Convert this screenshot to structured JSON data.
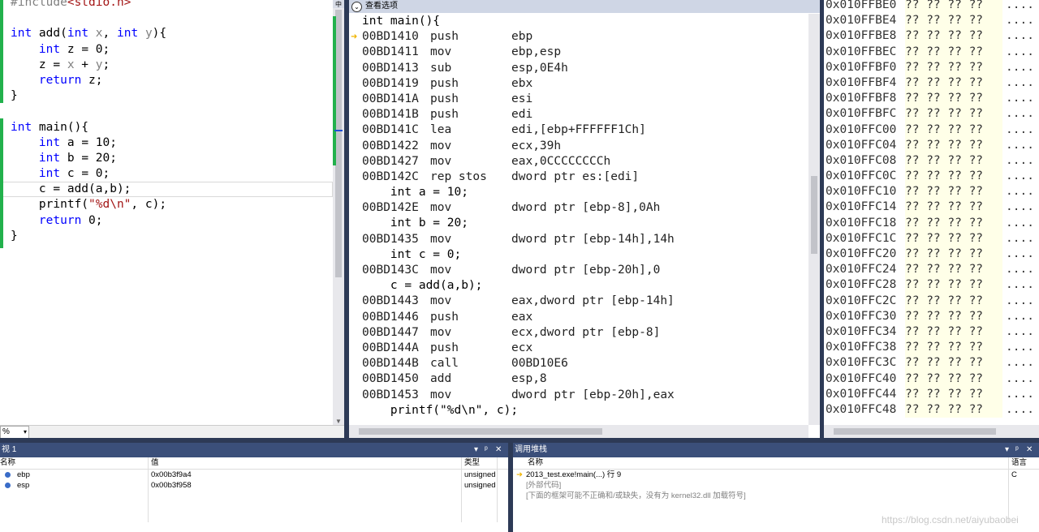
{
  "source_editor": {
    "zoom": "%",
    "lines": [
      {
        "kind": "include",
        "pp": "#include",
        "inc": "<stdio.h>"
      },
      {
        "kind": "blank"
      },
      {
        "kind": "code",
        "parts": [
          [
            "kw",
            "int"
          ],
          [
            "t",
            " add("
          ],
          [
            "kw",
            "int"
          ],
          [
            "t",
            " "
          ],
          [
            "par",
            "x"
          ],
          [
            "t",
            ", "
          ],
          [
            "kw",
            "int"
          ],
          [
            "t",
            " "
          ],
          [
            "par",
            "y"
          ],
          [
            "t",
            "){"
          ]
        ]
      },
      {
        "kind": "code",
        "parts": [
          [
            "t",
            "    "
          ],
          [
            "kw",
            "int"
          ],
          [
            "t",
            " z = 0;"
          ]
        ]
      },
      {
        "kind": "code",
        "parts": [
          [
            "t",
            "    z = "
          ],
          [
            "par",
            "x"
          ],
          [
            "t",
            " + "
          ],
          [
            "par",
            "y"
          ],
          [
            "t",
            ";"
          ]
        ]
      },
      {
        "kind": "code",
        "parts": [
          [
            "t",
            "    "
          ],
          [
            "kw",
            "return"
          ],
          [
            "t",
            " z;"
          ]
        ]
      },
      {
        "kind": "code",
        "parts": [
          [
            "t",
            "}"
          ]
        ]
      },
      {
        "kind": "blank"
      },
      {
        "kind": "code",
        "parts": [
          [
            "kw",
            "int"
          ],
          [
            "t",
            " main(){"
          ]
        ]
      },
      {
        "kind": "code",
        "parts": [
          [
            "t",
            "    "
          ],
          [
            "kw",
            "int"
          ],
          [
            "t",
            " a = 10;"
          ]
        ]
      },
      {
        "kind": "code",
        "parts": [
          [
            "t",
            "    "
          ],
          [
            "kw",
            "int"
          ],
          [
            "t",
            " b = 20;"
          ]
        ]
      },
      {
        "kind": "code",
        "parts": [
          [
            "t",
            "    "
          ],
          [
            "kw",
            "int"
          ],
          [
            "t",
            " c = 0;"
          ]
        ]
      },
      {
        "kind": "code",
        "current": true,
        "parts": [
          [
            "t",
            "    c = add(a,b);"
          ]
        ]
      },
      {
        "kind": "code",
        "parts": [
          [
            "t",
            "    printf("
          ],
          [
            "str",
            "\"%d\\n\""
          ],
          [
            "t",
            ", c);"
          ]
        ]
      },
      {
        "kind": "code",
        "parts": [
          [
            "t",
            "    "
          ],
          [
            "kw",
            "return"
          ],
          [
            "t",
            " 0;"
          ]
        ]
      },
      {
        "kind": "code",
        "parts": [
          [
            "t",
            "}"
          ]
        ]
      }
    ]
  },
  "disassembly": {
    "header": "查看选项",
    "rows": [
      {
        "src": "int main(){"
      },
      {
        "a": "00BD1410",
        "m": "push",
        "o": "ebp"
      },
      {
        "a": "00BD1411",
        "m": "mov",
        "o": "ebp,esp"
      },
      {
        "a": "00BD1413",
        "m": "sub",
        "o": "esp,0E4h"
      },
      {
        "a": "00BD1419",
        "m": "push",
        "o": "ebx"
      },
      {
        "a": "00BD141A",
        "m": "push",
        "o": "esi"
      },
      {
        "a": "00BD141B",
        "m": "push",
        "o": "edi"
      },
      {
        "a": "00BD141C",
        "m": "lea",
        "o": "edi,[ebp+FFFFFF1Ch]"
      },
      {
        "a": "00BD1422",
        "m": "mov",
        "o": "ecx,39h"
      },
      {
        "a": "00BD1427",
        "m": "mov",
        "o": "eax,0CCCCCCCCh"
      },
      {
        "a": "00BD142C",
        "m": "rep stos",
        "o": "dword ptr es:[edi]"
      },
      {
        "src": "    int a = 10;"
      },
      {
        "a": "00BD142E",
        "m": "mov",
        "o": "dword ptr [ebp-8],0Ah"
      },
      {
        "src": "    int b = 20;"
      },
      {
        "a": "00BD1435",
        "m": "mov",
        "o": "dword ptr [ebp-14h],14h"
      },
      {
        "src": "    int c = 0;"
      },
      {
        "a": "00BD143C",
        "m": "mov",
        "o": "dword ptr [ebp-20h],0"
      },
      {
        "src": "    c = add(a,b);"
      },
      {
        "a": "00BD1443",
        "m": "mov",
        "o": "eax,dword ptr [ebp-14h]"
      },
      {
        "a": "00BD1446",
        "m": "push",
        "o": "eax"
      },
      {
        "a": "00BD1447",
        "m": "mov",
        "o": "ecx,dword ptr [ebp-8]"
      },
      {
        "a": "00BD144A",
        "m": "push",
        "o": "ecx"
      },
      {
        "a": "00BD144B",
        "m": "call",
        "o": "00BD10E6"
      },
      {
        "a": "00BD1450",
        "m": "add",
        "o": "esp,8"
      },
      {
        "a": "00BD1453",
        "m": "mov",
        "o": "dword ptr [ebp-20h],eax"
      },
      {
        "src": "    printf(\"%d\\n\", c);"
      }
    ]
  },
  "memory": {
    "rows": [
      {
        "addr": "0x010FFBE0",
        "bytes": "?? ?? ?? ??",
        "chars": "...."
      },
      {
        "addr": "0x010FFBE4",
        "bytes": "?? ?? ?? ??",
        "chars": "...."
      },
      {
        "addr": "0x010FFBE8",
        "bytes": "?? ?? ?? ??",
        "chars": "...."
      },
      {
        "addr": "0x010FFBEC",
        "bytes": "?? ?? ?? ??",
        "chars": "...."
      },
      {
        "addr": "0x010FFBF0",
        "bytes": "?? ?? ?? ??",
        "chars": "...."
      },
      {
        "addr": "0x010FFBF4",
        "bytes": "?? ?? ?? ??",
        "chars": "...."
      },
      {
        "addr": "0x010FFBF8",
        "bytes": "?? ?? ?? ??",
        "chars": "...."
      },
      {
        "addr": "0x010FFBFC",
        "bytes": "?? ?? ?? ??",
        "chars": "...."
      },
      {
        "addr": "0x010FFC00",
        "bytes": "?? ?? ?? ??",
        "chars": "...."
      },
      {
        "addr": "0x010FFC04",
        "bytes": "?? ?? ?? ??",
        "chars": "...."
      },
      {
        "addr": "0x010FFC08",
        "bytes": "?? ?? ?? ??",
        "chars": "...."
      },
      {
        "addr": "0x010FFC0C",
        "bytes": "?? ?? ?? ??",
        "chars": "...."
      },
      {
        "addr": "0x010FFC10",
        "bytes": "?? ?? ?? ??",
        "chars": "...."
      },
      {
        "addr": "0x010FFC14",
        "bytes": "?? ?? ?? ??",
        "chars": "...."
      },
      {
        "addr": "0x010FFC18",
        "bytes": "?? ?? ?? ??",
        "chars": "...."
      },
      {
        "addr": "0x010FFC1C",
        "bytes": "?? ?? ?? ??",
        "chars": "...."
      },
      {
        "addr": "0x010FFC20",
        "bytes": "?? ?? ?? ??",
        "chars": "...."
      },
      {
        "addr": "0x010FFC24",
        "bytes": "?? ?? ?? ??",
        "chars": "...."
      },
      {
        "addr": "0x010FFC28",
        "bytes": "?? ?? ?? ??",
        "chars": "...."
      },
      {
        "addr": "0x010FFC2C",
        "bytes": "?? ?? ?? ??",
        "chars": "...."
      },
      {
        "addr": "0x010FFC30",
        "bytes": "?? ?? ?? ??",
        "chars": "...."
      },
      {
        "addr": "0x010FFC34",
        "bytes": "?? ?? ?? ??",
        "chars": "...."
      },
      {
        "addr": "0x010FFC38",
        "bytes": "?? ?? ?? ??",
        "chars": "...."
      },
      {
        "addr": "0x010FFC3C",
        "bytes": "?? ?? ?? ??",
        "chars": "...."
      },
      {
        "addr": "0x010FFC40",
        "bytes": "?? ?? ?? ??",
        "chars": "...."
      },
      {
        "addr": "0x010FFC44",
        "bytes": "?? ?? ?? ??",
        "chars": "...."
      },
      {
        "addr": "0x010FFC48",
        "bytes": "?? ?? ?? ??",
        "chars": "...."
      }
    ]
  },
  "watch_panel": {
    "title": "视 1",
    "controls": {
      "pin": "▾",
      "dock": "ᵖ",
      "close": "✕"
    },
    "columns": {
      "name": "名称",
      "value": "值",
      "type": "类型"
    },
    "rows": [
      {
        "name": "ebp",
        "value": "0x00b3f9a4",
        "type": "unsigned"
      },
      {
        "name": "esp",
        "value": "0x00b3f958",
        "type": "unsigned"
      }
    ]
  },
  "callstack_panel": {
    "title": "调用堆栈",
    "controls": {
      "pin": "▾",
      "dock": "ᵖ",
      "close": "✕"
    },
    "columns": {
      "name": "名称",
      "lang": "语言"
    },
    "rows": [
      {
        "name": "2013_test.exe!main(...) 行 9",
        "lang": "C",
        "current": true,
        "gray": false
      },
      {
        "name": "[外部代码]",
        "lang": "",
        "current": false,
        "gray": true
      },
      {
        "name": "[下面的框架可能不正确和/或缺失，没有为 kernel32.dll 加载符号]",
        "lang": "",
        "current": false,
        "gray": true
      }
    ]
  },
  "watermark": "https://blog.csdn.net/aiyubaobei"
}
